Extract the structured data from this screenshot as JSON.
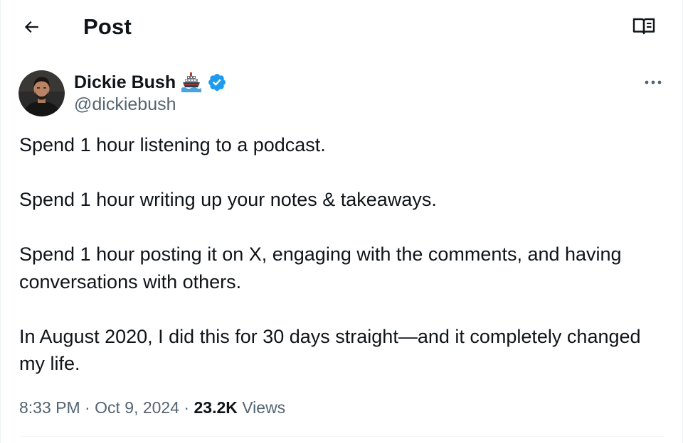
{
  "header": {
    "title": "Post",
    "back_icon": "arrow-left-icon",
    "reader_icon": "book-open-icon"
  },
  "author": {
    "name": "Dickie Bush",
    "handle": "@dickiebush",
    "name_emoji": "ship-emoji",
    "verified": true,
    "verified_color": "#1d9bf0"
  },
  "tweet": {
    "paragraphs": [
      "Spend 1 hour listening to a podcast.",
      "Spend 1 hour writing up your notes & takeaways.",
      "Spend 1 hour posting it on X, engaging with the comments, and having conversations with others.",
      "In August 2020, I did this for 30 days straight—and it completely changed my life."
    ]
  },
  "meta": {
    "time": "8:33 PM",
    "separator": "·",
    "date": "Oct 9, 2024",
    "views_count": "23.2K",
    "views_label": "Views"
  },
  "colors": {
    "text": "#0f1419",
    "secondary": "#536471",
    "border": "#eff3f4",
    "accent": "#1d9bf0"
  }
}
